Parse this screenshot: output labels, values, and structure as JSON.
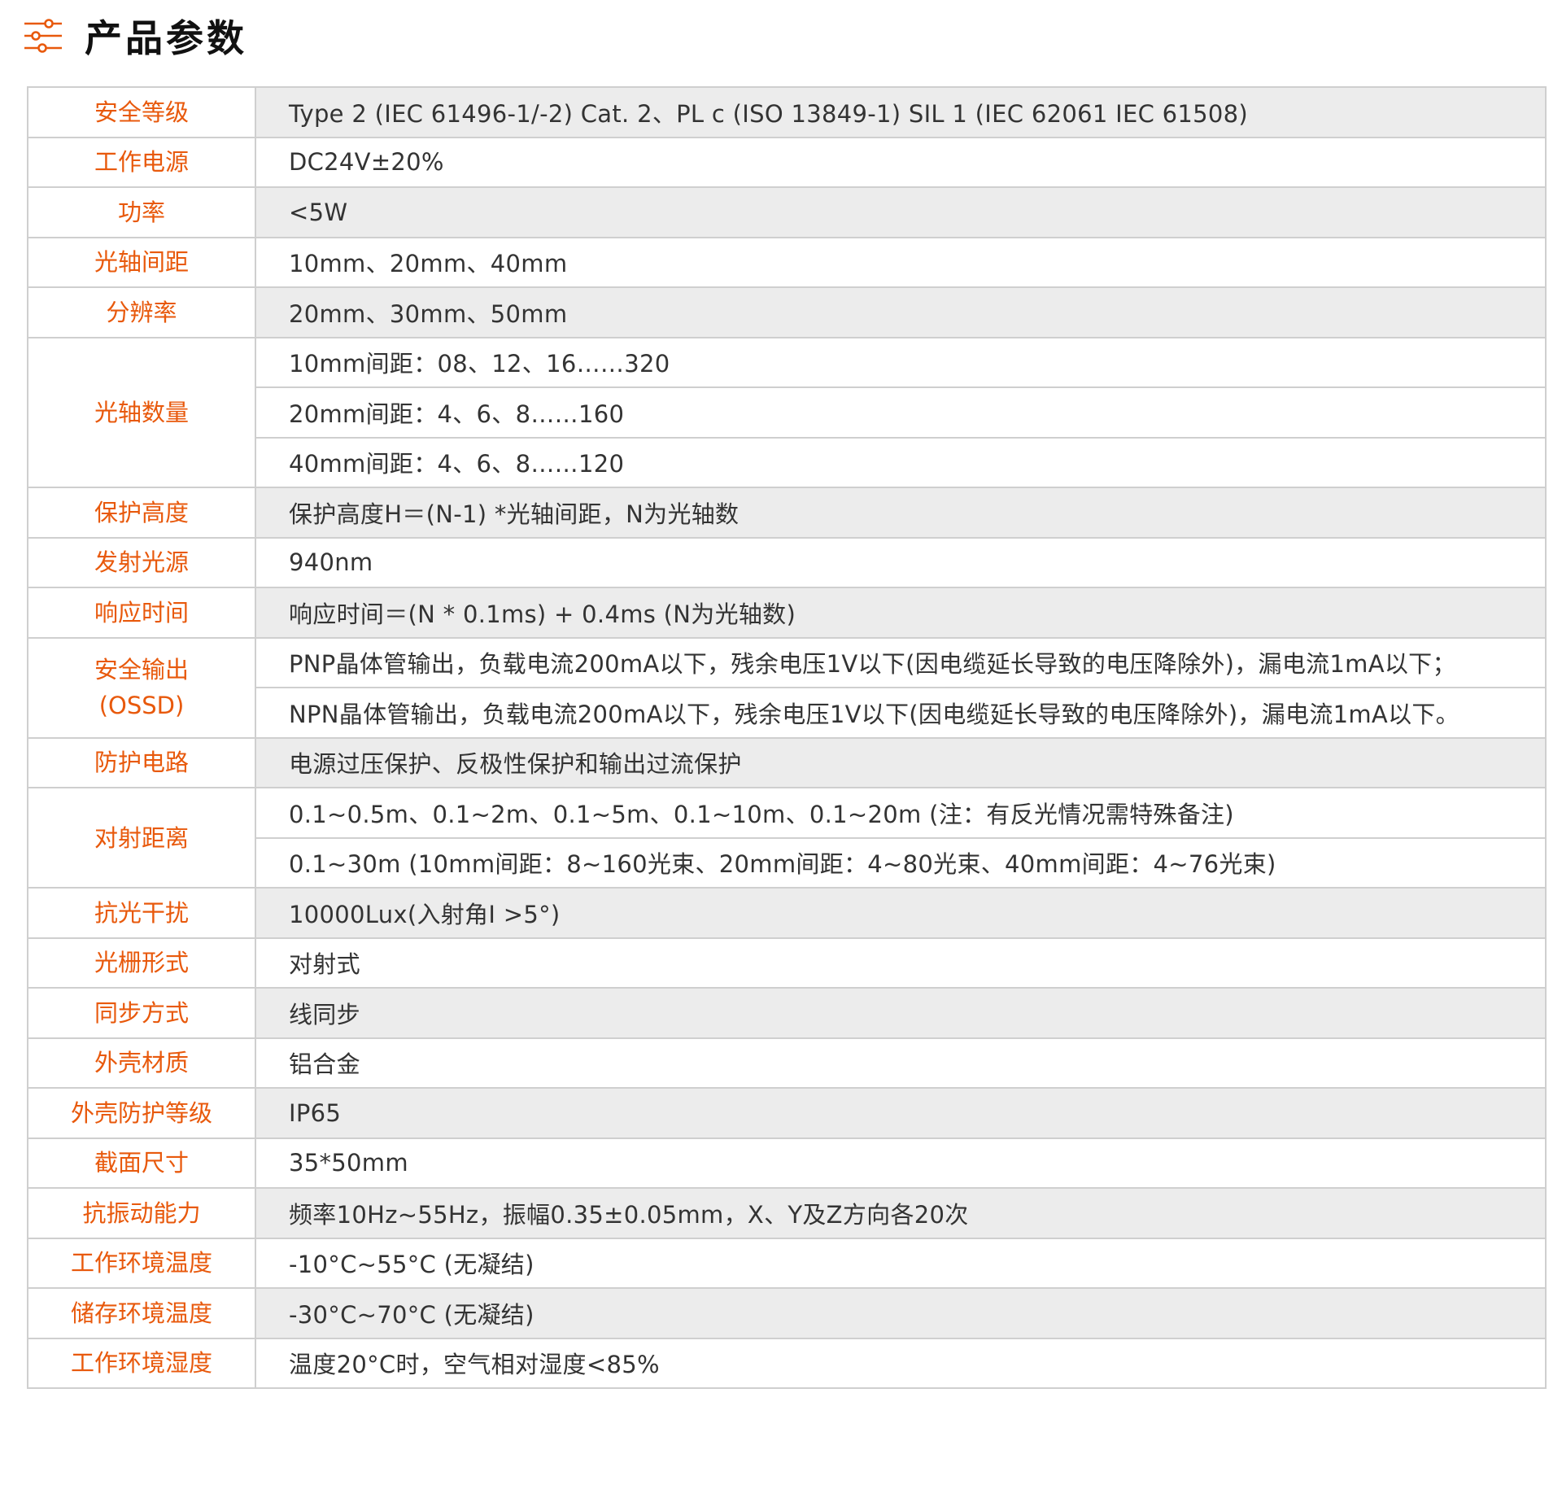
{
  "page_title": "产品参数",
  "header_icon": "sliders-icon",
  "accent_color": "#e8590c",
  "spec_rows": [
    {
      "label": "安全等级",
      "value": "Type 2 (IEC 61496-1/-2) Cat. 2、PL c (ISO 13849-1)  SIL 1 (IEC 62061 IEC 61508)"
    },
    {
      "label": "工作电源",
      "value": "DC24V±20%"
    },
    {
      "label": "功率",
      "value": "<5W"
    },
    {
      "label": "光轴间距",
      "value": "10mm、20mm、40mm"
    },
    {
      "label": "分辨率",
      "value": "20mm、30mm、50mm"
    },
    {
      "label": "光轴数量",
      "values": [
        "10mm间距：08、12、16……320",
        "20mm间距：4、6、8……160",
        "40mm间距：4、6、8……120"
      ]
    },
    {
      "label": "保护高度",
      "value": "保护高度H＝(N-1) *光轴间距，N为光轴数"
    },
    {
      "label": "发射光源",
      "value": "940nm"
    },
    {
      "label": "响应时间",
      "value": "响应时间＝(N * 0.1ms) + 0.4ms (N为光轴数)"
    },
    {
      "label": "安全输出",
      "label2": "(OSSD)",
      "values": [
        "PNP晶体管输出，负载电流200mA以下，残余电压1V以下(因电缆延长导致的电压降除外)，漏电流1mA以下；",
        "NPN晶体管输出，负载电流200mA以下，残余电压1V以下(因电缆延长导致的电压降除外)，漏电流1mA以下。"
      ]
    },
    {
      "label": "防护电路",
      "value": "电源过压保护、反极性保护和输出过流保护"
    },
    {
      "label": "对射距离",
      "values": [
        "0.1~0.5m、0.1~2m、0.1~5m、0.1~10m、0.1~20m (注：有反光情况需特殊备注)",
        "0.1~30m (10mm间距：8~160光束、20mm间距：4~80光束、40mm间距：4~76光束)"
      ]
    },
    {
      "label": "抗光干扰",
      "value": "10000Lux(入射角I >5°)"
    },
    {
      "label": "光栅形式",
      "value": "对射式"
    },
    {
      "label": "同步方式",
      "value": "线同步"
    },
    {
      "label": "外壳材质",
      "value": "铝合金"
    },
    {
      "label": "外壳防护等级",
      "value": "IP65"
    },
    {
      "label": "截面尺寸",
      "value": "35*50mm"
    },
    {
      "label": "抗振动能力",
      "value": "频率10Hz~55Hz，振幅0.35±0.05mm，X、Y及Z方向各20次"
    },
    {
      "label": "工作环境温度",
      "value": "-10°C~55°C (无凝结)"
    },
    {
      "label": "储存环境温度",
      "value": "-30°C~70°C (无凝结)"
    },
    {
      "label": "工作环境湿度",
      "value": "温度20°C时，空气相对湿度<85%"
    }
  ]
}
